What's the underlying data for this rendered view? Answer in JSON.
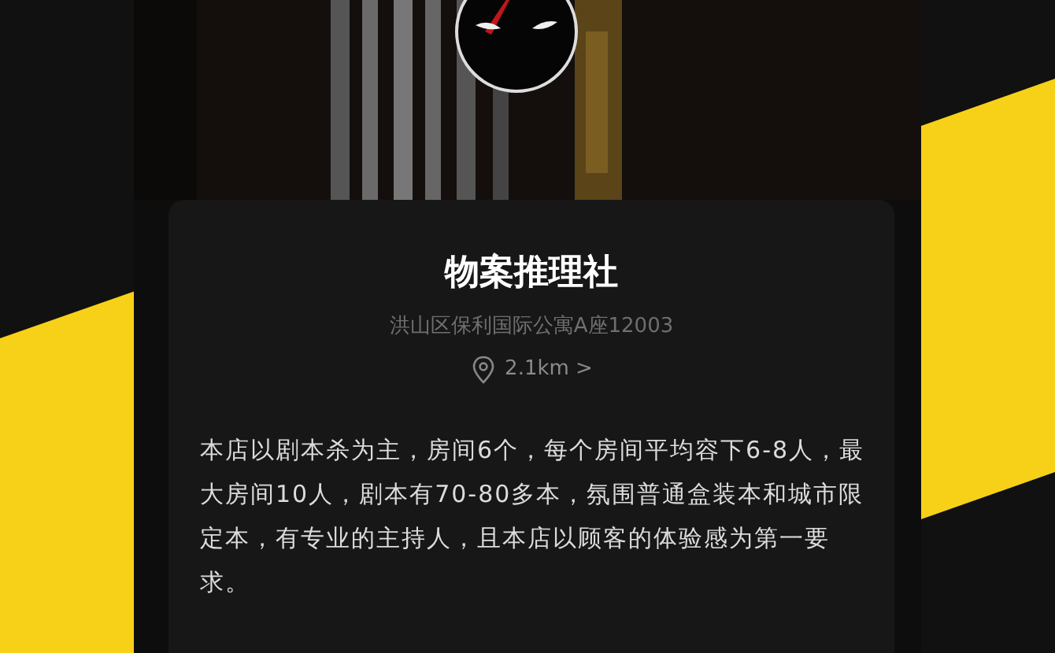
{
  "store": {
    "name": "物案推理社",
    "address": "洪山区保利国际公寓A座12003",
    "distance": "2.1km >",
    "description": "本店以剧本杀为主，房间6个，每个房间平均容下6-8人，最大房间10人，剧本有70-80多本，氛围普通盒装本和城市限定本，有专业的主持人，且本店以顾客的体验感为第一要求。"
  }
}
